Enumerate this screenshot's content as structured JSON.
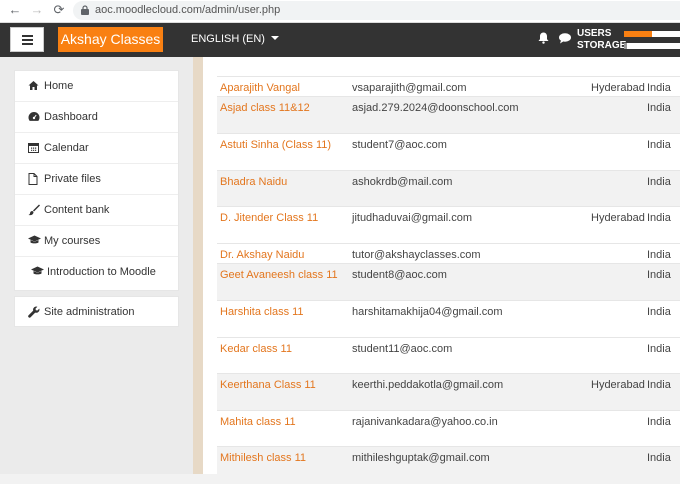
{
  "browser": {
    "url": "aoc.moodlecloud.com/admin/user.php",
    "back_icon": "←",
    "forward_icon": "→",
    "reload_icon": "⟳"
  },
  "navbar": {
    "brand": "Akshay Classes",
    "language": "ENGLISH (EN)",
    "users_label": "USERS",
    "storage_label": "STORAGE",
    "users_usage_fraction": 0.5,
    "storage_usage_fraction": 0.05,
    "accent_color": "#f98012"
  },
  "sidebar": {
    "items": [
      {
        "label": "Home",
        "icon": "home-icon"
      },
      {
        "label": "Dashboard",
        "icon": "dashboard-icon"
      },
      {
        "label": "Calendar",
        "icon": "calendar-icon"
      },
      {
        "label": "Private files",
        "icon": "file-icon"
      },
      {
        "label": "Content bank",
        "icon": "paintbrush-icon"
      },
      {
        "label": "My courses",
        "icon": "graduation-cap-icon"
      },
      {
        "label": "Introduction to Moodle",
        "icon": "graduation-cap-icon"
      }
    ],
    "site_admin": {
      "label": "Site administration",
      "icon": "wrench-icon"
    }
  },
  "users": [
    {
      "name": "Aparajith Vangal",
      "email": "vsaparajith@gmail.com",
      "city": "Hyderabad",
      "country": "India"
    },
    {
      "name": "Asjad class 11&12",
      "email": "asjad.279.2024@doonschool.com",
      "city": "",
      "country": "India"
    },
    {
      "name": "Astuti Sinha (Class 11)",
      "email": "student7@aoc.com",
      "city": "",
      "country": "India"
    },
    {
      "name": "Bhadra Naidu",
      "email": "ashokrdb@mail.com",
      "city": "",
      "country": "India"
    },
    {
      "name": "D. Jitender Class 11",
      "email": "jitudhaduvai@gmail.com",
      "city": "Hyderabad",
      "country": "India"
    },
    {
      "name": "Dr. Akshay Naidu",
      "email": "tutor@akshayclasses.com",
      "city": "",
      "country": "India"
    },
    {
      "name": "Geet Avaneesh class 11",
      "email": "student8@aoc.com",
      "city": "",
      "country": "India"
    },
    {
      "name": "Harshita class 11",
      "email": "harshitamakhija04@gmail.com",
      "city": "",
      "country": "India"
    },
    {
      "name": "Kedar class 11",
      "email": "student11@aoc.com",
      "city": "",
      "country": "India"
    },
    {
      "name": "Keerthana Class 11",
      "email": "keerthi.peddakotla@gmail.com",
      "city": "Hyderabad",
      "country": "India"
    },
    {
      "name": "Mahita class 11",
      "email": "rajanivankadara@yahoo.co.in",
      "city": "",
      "country": "India"
    },
    {
      "name": "Mithilesh class 11",
      "email": "mithileshguptak@gmail.com",
      "city": "",
      "country": "India"
    }
  ]
}
